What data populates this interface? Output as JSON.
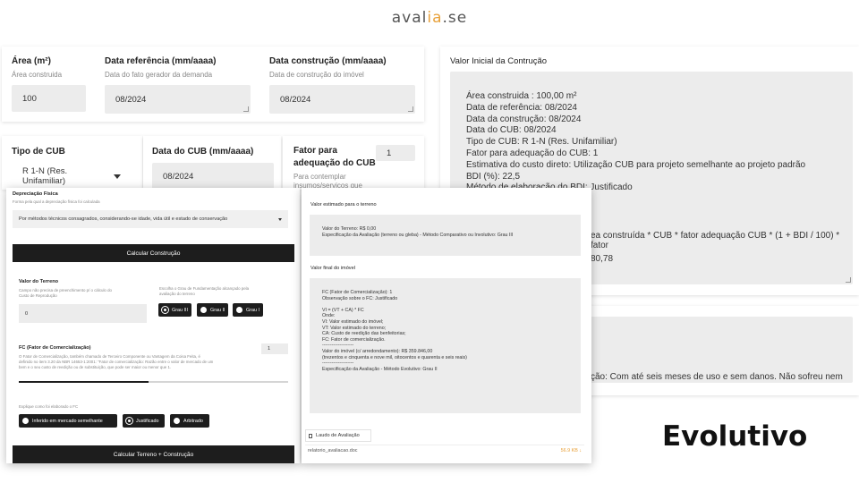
{
  "brand": {
    "part1": "aval",
    "part2": "ia",
    "part3": ".se"
  },
  "area": {
    "label": "Área (m²)",
    "hint": "Área construida",
    "value": "100"
  },
  "data_ref": {
    "label": "Data referência (mm/aaaa)",
    "hint": "Data do fato gerador da demanda",
    "value": "08/2024"
  },
  "data_constr": {
    "label": "Data construção (mm/aaaa)",
    "hint": "Data de construção do imóvel",
    "value": "08/2024"
  },
  "tipo_cub": {
    "label": "Tipo de CUB",
    "value": "R 1-N (Res. Unifamiliar)"
  },
  "data_cub": {
    "label": "Data do CUB (mm/aaaa)",
    "value": "08/2024"
  },
  "fator_cub": {
    "label_line1": "Fator para",
    "label_line2": "adequação do CUB",
    "hint_line1": "Para contemplar",
    "hint_line2": "insumos/serviços que",
    "value": "1"
  },
  "valor_inicial": {
    "title": "Valor Inicial da Contrução",
    "lines": [
      "Área construida : 100,00 m²",
      "Data de referência: 08/2024",
      "Data da construção: 08/2024",
      "Data do CUB: 08/2024",
      "Tipo de CUB: R 1-N (Res. Unifamiliar)",
      "Fator para adequação do CUB: 1",
      "Estimativa do custo direto: Utilização CUB para projeto semelhante ao projeto padrão",
      "BDI (%): 22,5",
      "Método de elaboração do BDI: Justificado"
    ],
    "partial_formula": "ea construída * CUB * fator adequação CUB * (1 + BDI / 100) * fator",
    "partial_value": "80,78"
  },
  "estado_partial": "ção: Com até seis meses de uso e sem danos. Não sofreu nem",
  "depreciacao": {
    "label": "Depreciação Física",
    "hint": "Forma pela qual a depreciação física foi calculada",
    "value": "Por métodos técnicos consagrados, considerando-se idade, vida útil e estado de conservação"
  },
  "buttons": {
    "calcular_construcao": "Calcular Construção",
    "calcular_terreno": "Calcular Terreno + Construção"
  },
  "valor_terreno": {
    "label": "Valor do Terreno",
    "hint_line1": "Campo não precisa de preenchimento p/ o cálculo do",
    "hint_line2": "Custo de Reprodução",
    "value": "0"
  },
  "grau": {
    "hint_line1": "Escolha o Grau de Fundamentação alcançado pela",
    "hint_line2": "avaliação do terreno",
    "options": [
      "Grau III",
      "Grau II",
      "Grau I"
    ],
    "selected": "Grau III"
  },
  "fc": {
    "label": "FC (Fator de Comercialização)",
    "value": "1",
    "hint_line1": "O Fator de Comercialização, também chamado de Terceiro Componente ou Vantagem da Coisa Feita, é",
    "hint_line2": "definido no item 3.20 da NBR 14653-1:2001: \"Fator de comercialização: Razão entre o valor de mercado de um",
    "hint_line3": "bem e o seu custo de reedição ou de substituição, que pode ser maior ou menor que 1."
  },
  "fc_method": {
    "hint": "Explique como foi elaborado o FC",
    "options": [
      "Inferido em mercado semelhante",
      "Justificado",
      "Arbitrado"
    ],
    "selected": "Justificado"
  },
  "valor_estimado_terreno": {
    "title": "Valor estimado para o terreno",
    "lines": [
      "Valor do Terreno: R$ 0,00",
      "Especificação da Avaliação (terreno ou gleba) -  Método Comparativo ou Involutivo: Grau III"
    ]
  },
  "valor_final": {
    "title": "Valor final do imóvel",
    "lines": [
      "FC (Fator de Comercialização): 1",
      "Observação sobre o FC: Justificado",
      "",
      "VI = (VT + CA) * FC",
      "Onde:",
      "VI: Valor estimado do imóvel;",
      "VT: Valor estimado do terreno;",
      "CA: Custo de reedição das benfeitorias;",
      "FC: Fator de comercialização.",
      "--------------------",
      "Valor do imóvel (c/ arredondamento): R$ 359.846,00",
      "(trezentos e cinquenta e nove mil, oitocentos e quarenta e seis reais)",
      "--------------------",
      "Especificação da Avaliação - Método Evolutivo: Grau II"
    ]
  },
  "laudo": {
    "title": "Laudo de Avaliação",
    "file_name": "relatorio_avaliacao.doc",
    "file_size": "56.9 KB"
  },
  "caption": "Evolutivo"
}
